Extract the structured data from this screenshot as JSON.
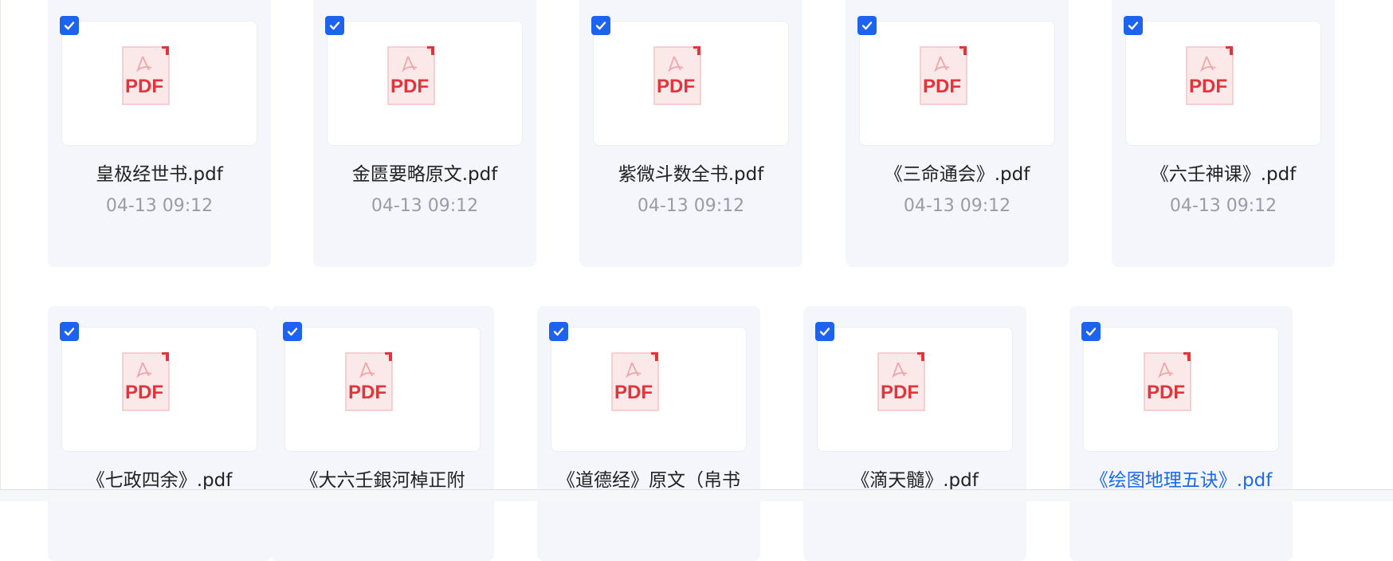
{
  "files": [
    {
      "name": "皇极经世书.pdf",
      "date": "04-13 09:12",
      "checked": true
    },
    {
      "name": "金匮要略原文.pdf",
      "date": "04-13 09:12",
      "checked": true
    },
    {
      "name": "紫微斗数全书.pdf",
      "date": "04-13 09:12",
      "checked": true
    },
    {
      "name": "《三命通会》.pdf",
      "date": "04-13 09:12",
      "checked": true
    },
    {
      "name": "《六壬神课》.pdf",
      "date": "04-13 09:12",
      "checked": true
    },
    {
      "name": "《七政四余》.pdf",
      "checked": true
    },
    {
      "name": "《大六壬銀河棹正附",
      "checked": true
    },
    {
      "name": "《道德经》原文（帛书",
      "checked": true
    },
    {
      "name": "《滴天髓》.pdf",
      "checked": true
    },
    {
      "name": "《绘图地理五诀》.pdf",
      "checked": true,
      "hovered": true
    }
  ],
  "icons": {
    "file": "pdf-file-icon",
    "check": "checkmark-icon"
  },
  "pdf_label": "PDF",
  "colors": {
    "accent": "#1d63ef",
    "link": "#1a6af0",
    "pdf_red": "#e0353b",
    "card_bg": "#f5f6fb"
  }
}
